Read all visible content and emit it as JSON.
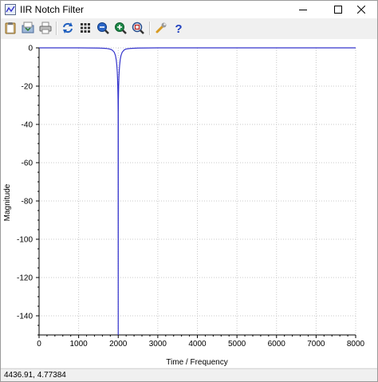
{
  "window": {
    "title": "IIR Notch Filter"
  },
  "toolbar": {
    "buttons": [
      {
        "icon": "clipboard-icon"
      },
      {
        "icon": "save-icon"
      },
      {
        "icon": "print-icon"
      },
      {
        "icon": "refresh-icon"
      },
      {
        "icon": "grid-icon"
      },
      {
        "icon": "zoom-out-icon"
      },
      {
        "icon": "zoom-in-icon"
      },
      {
        "icon": "zoom-fit-icon"
      },
      {
        "icon": "settings-wrench-icon"
      },
      {
        "icon": "help-icon"
      }
    ]
  },
  "chart_data": {
    "type": "line",
    "title": "",
    "xlabel": "Time / Frequency",
    "ylabel": "Magnitude",
    "xlim": [
      0,
      8000
    ],
    "ylim": [
      -150,
      0
    ],
    "xticks": [
      0,
      1000,
      2000,
      3000,
      4000,
      5000,
      6000,
      7000,
      8000
    ],
    "yticks": [
      0,
      -20,
      -40,
      -60,
      -80,
      -100,
      -120,
      -140
    ],
    "grid": true,
    "line_color": "#3333cc",
    "notch_frequency": 2000,
    "series": [
      {
        "x": [
          0,
          500,
          1000,
          1500,
          1700,
          1800,
          1850,
          1900,
          1930,
          1950,
          1965,
          1975,
          1982,
          1988,
          1992,
          1995,
          1998,
          2000,
          2002,
          2005,
          2008,
          2012,
          2018,
          2025,
          2035,
          2050,
          2070,
          2100,
          2150,
          2200,
          2300,
          2500,
          3000,
          4000,
          5000,
          6000,
          7000,
          8000
        ],
        "y": [
          0,
          0,
          0,
          -0.1,
          -0.3,
          -0.7,
          -1.2,
          -2.3,
          -4,
          -6.3,
          -9.2,
          -12.3,
          -15.6,
          -19.7,
          -23.2,
          -26.7,
          -34,
          -150,
          -34,
          -26.7,
          -22.8,
          -19.2,
          -15.3,
          -12.3,
          -9.3,
          -6.2,
          -4,
          -2.3,
          -1.1,
          -0.6,
          -0.3,
          -0.1,
          0,
          0,
          0,
          0,
          0,
          0
        ]
      }
    ]
  },
  "status": {
    "coords": "4436.91, 4.77384"
  }
}
